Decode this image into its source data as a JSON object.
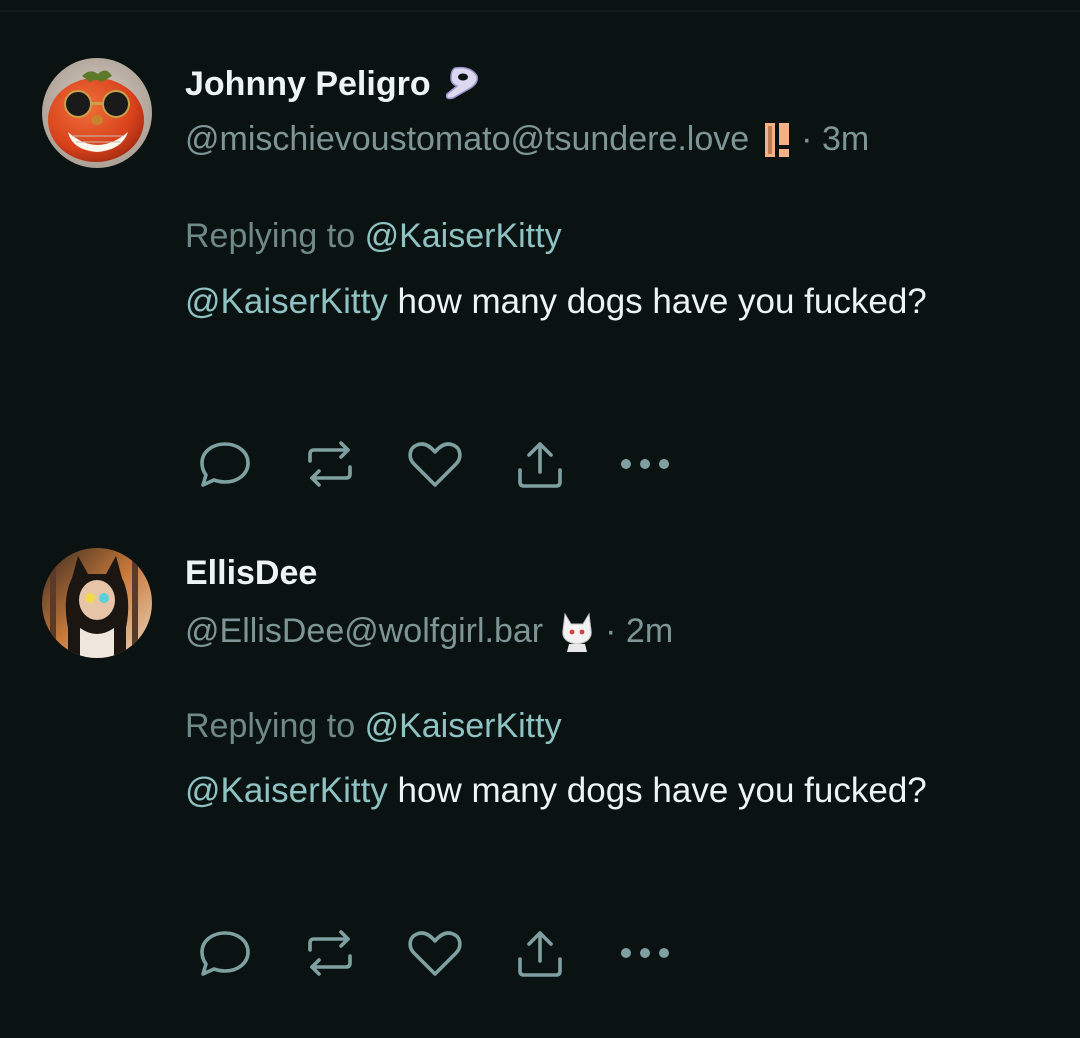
{
  "posts": [
    {
      "display_name": "Johnny Peligro",
      "handle": "@mischievoustomato@tsundere.love",
      "time": "· 3m",
      "replying_label": "Replying to",
      "replying_to": "@KaiserKitty",
      "mention": "@KaiserKitty",
      "text": " how many dogs have you fucked?",
      "avatar_icon": "tomato-sunglasses-avatar",
      "name_badge_icon": "gentoo-logo-icon",
      "handle_badge_icon": "pause-badge-icon"
    },
    {
      "display_name": "EllisDee",
      "handle": "@EllisDee@wolfgirl.bar",
      "time": "· 2m",
      "replying_label": "Replying to",
      "replying_to": "@KaiserKitty",
      "mention": "@KaiserKitty",
      "text": " how many dogs have you fucked?",
      "avatar_icon": "wolfgirl-avatar",
      "handle_badge_icon": "white-cat-girl-emoji"
    }
  ],
  "actions": [
    "reply-icon",
    "repost-icon",
    "like-icon",
    "share-icon",
    "more-icon"
  ],
  "colors": {
    "background": "#0b1212",
    "mention": "#8fc3c3",
    "muted": "#7d9595",
    "icon": "#7fa0a0"
  }
}
